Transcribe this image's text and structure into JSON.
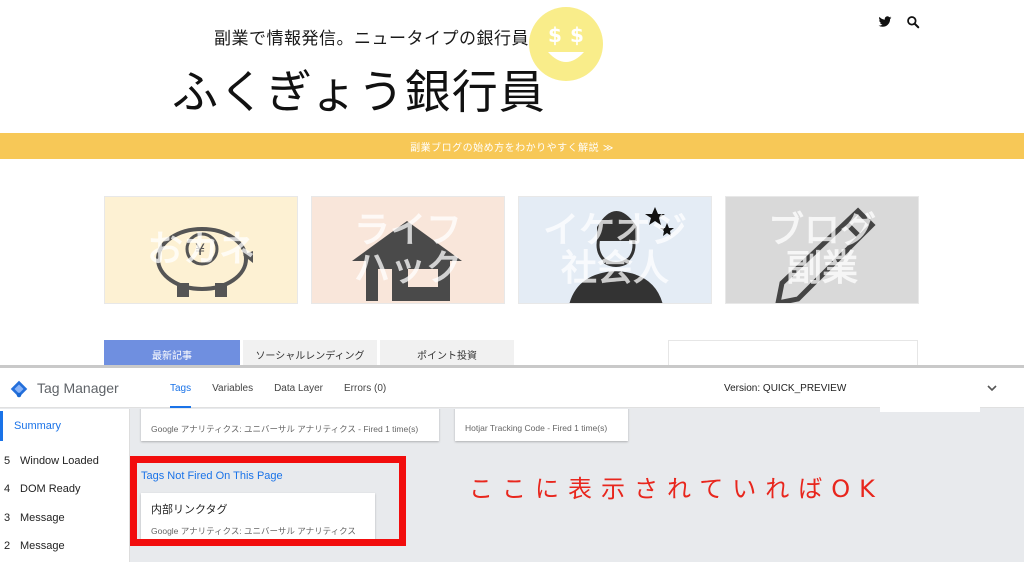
{
  "blog": {
    "tagline": "副業で情報発信。ニュータイプの銀行員。",
    "site_title": "ふくぎょう銀行員",
    "banner_text": "副業ブログの始め方をわかりやすく解説 ≫",
    "categories": [
      {
        "label": "おカネ",
        "bg": "#fdf1d3",
        "icon": "piggy-bank-icon"
      },
      {
        "label": "ライフ\nハック",
        "bg": "#f9e6da",
        "icon": "house-icon"
      },
      {
        "label": "イケオジ\n社会人",
        "bg": "#e4ecf5",
        "icon": "man-icon"
      },
      {
        "label": "ブログ\n副業",
        "bg": "#d9d9d9",
        "icon": "pencil-icon"
      }
    ],
    "tabs": [
      "最新記事",
      "ソーシャルレンディング",
      "ポイント投資"
    ],
    "active_tab": "最新記事"
  },
  "gtm": {
    "product_name": "Tag Manager",
    "tabs": [
      "Tags",
      "Variables",
      "Data Layer",
      "Errors (0)"
    ],
    "active_tab": "Tags",
    "version": "Version: QUICK_PREVIEW",
    "sidebar": {
      "summary": "Summary",
      "events": [
        {
          "num": "5",
          "name": "Window Loaded"
        },
        {
          "num": "4",
          "name": "DOM Ready"
        },
        {
          "num": "3",
          "name": "Message"
        },
        {
          "num": "2",
          "name": "Message"
        }
      ]
    },
    "fired_cards": [
      {
        "footer": "Google アナリティクス: ユニバーサル アナリティクス - Fired 1 time(s)"
      },
      {
        "footer": "Hotjar Tracking Code - Fired 1 time(s)"
      }
    ],
    "not_fired_title": "Tags Not Fired On This Page",
    "not_fired_card": {
      "name": "内部リンクタグ",
      "footer": "Google アナリティクス: ユニバーサル アナリティクス"
    }
  },
  "annotation": {
    "note": "ここに表示されていればOK",
    "color": "#f20d0d"
  },
  "colors": {
    "accent_yellow": "#f7c857",
    "gtm_blue": "#1a73e8",
    "tab_blue": "#6f8fe0"
  }
}
